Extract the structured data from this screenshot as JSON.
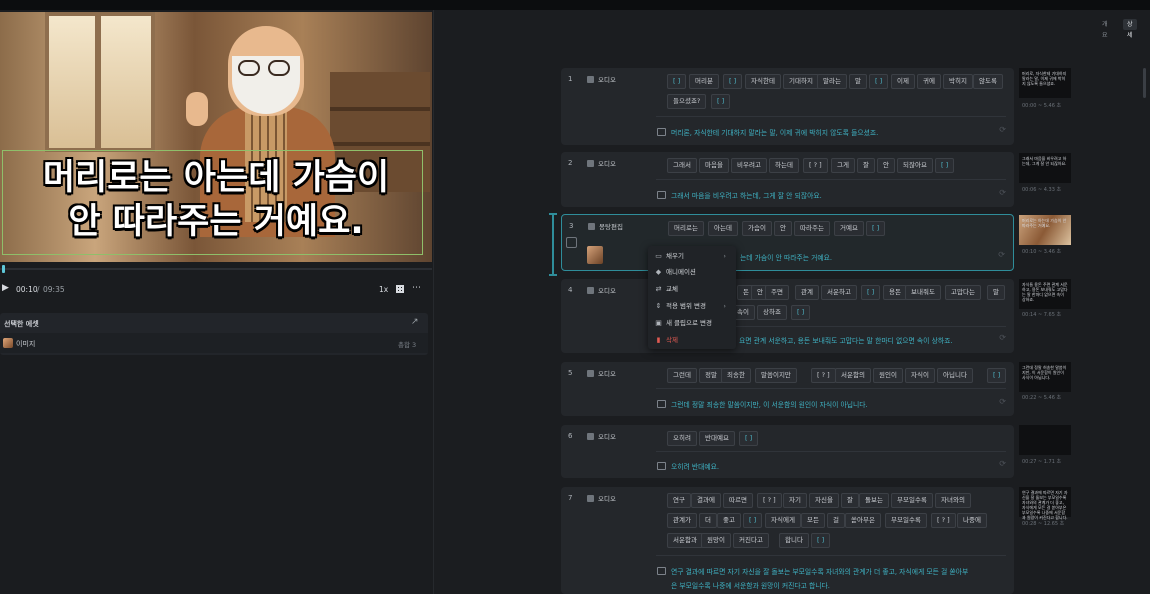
{
  "video": {
    "subtitle_line1": "머리로는 아는데 가슴이",
    "subtitle_line2": "안 따라주는 거예요.",
    "time_current": "00:10",
    "time_sep": "/",
    "time_total": "09:35",
    "speed": "1x"
  },
  "assets": {
    "title": "선택한 에셋",
    "item_label": "이미지",
    "item_count": "총합 3"
  },
  "view_tabs": [
    "개요",
    "상세"
  ],
  "rows": [
    {
      "num": "1",
      "type": "오디오",
      "thumb_text": "머리로, 자식한테 기대하지 말라는 말, 이제 귀에 박히지 않도록 들으셨죠.",
      "thumb_time": "00:00 ~ 5.46 초",
      "words": [
        "[ ]",
        "머리분",
        "[ ]",
        "자식한테",
        "기대하지",
        "말라는",
        "말",
        "[ ]",
        "이제",
        "귀에",
        "박히지",
        "않도록",
        "들으셨죠?",
        "[ ]"
      ],
      "sentence": "머리론, 자식한테 기대하지 말라는 말, 이제 귀에 박히지 않도록 들으셨죠."
    },
    {
      "num": "2",
      "type": "오디오",
      "thumb_text": "그래서 마음을 비우려고 하는데, 그게 잘 안 되잖아요.",
      "thumb_time": "00:06 ~ 4.33 초",
      "words": [
        "그래서",
        "마음을",
        "비우려고",
        "하는데",
        "[ ? ]",
        "그게",
        "잘",
        "안",
        "되잖아요",
        "[ ]"
      ],
      "sentence": "그래서 마음을 비우려고 하는데, 그게 잘 안 되잖아요."
    },
    {
      "num": "3",
      "type": "몽탕편집",
      "thumb_text": "머리로는 아는데 가슴이 안 따라주는 거예요.",
      "thumb_time": "00:10 ~ 3.46 초",
      "words": [
        "머리로는",
        "아는데",
        "가슴이",
        "안",
        "따라주는",
        "거예요",
        "[ ]"
      ],
      "sentence": "는데 가슴이 안 따라주는 거예요."
    },
    {
      "num": "4",
      "type": "오디오",
      "thumb_text": "자식들 용돈 주면 관계 서운하고, 용돈 보내줘도 고맙다는 말 한마디 없으면 속이 상하죠.",
      "thumb_time": "00:14 ~ 7.65 초",
      "words": [
        "돈",
        "안",
        "주면",
        "관계",
        "서운하고",
        "[ ]",
        "용돈",
        "보내줘도",
        "고맙다는",
        "말",
        "속이",
        "상하죠",
        "[ ]"
      ],
      "sentence": "요면 관계 서운하고, 용돈 보내줘도 고맙다는 말 한마디 없으면 속이 상하죠."
    },
    {
      "num": "5",
      "type": "오디오",
      "thumb_text": "그런데 정말 허송한 말씀이지만, 이 서운함이 원인이 사식이 아닙니다.",
      "thumb_time": "00:22 ~ 5.46 초",
      "words": [
        "그런데",
        "정말",
        "죄송한",
        "말씀이지만",
        "[ ? ]",
        "서운함의",
        "원인이",
        "자식이",
        "아닙니다",
        "[ ]"
      ],
      "sentence": "그런데 정말 죄송한 말씀이지만, 이 서운함의 원인이 자식이 아닙니다."
    },
    {
      "num": "6",
      "type": "오디오",
      "thumb_text": "",
      "thumb_time": "00:27 ~ 1.71 초",
      "words": [
        "오히려",
        "반대예요",
        "[ ]"
      ],
      "sentence": "오히려 반대예요."
    },
    {
      "num": "7",
      "type": "오디오",
      "thumb_text": "연구 결과에 따르면 자기 자신을 잘 돌보는 부모일수록 자녀와의 관계가 더 좋고, 자식에게 모든 걸 쏟아부은 부모일수록 나중에 서운함과 원망이 커진다고 합니다.",
      "thumb_time": "00:28 ~ 12.65 초",
      "words_line1": [
        "연구",
        "결과에",
        "따르면",
        "[ ? ]",
        "자기",
        "자신을",
        "잘",
        "돌보는",
        "부모일수록",
        "자녀와의"
      ],
      "words_line2": [
        "관계가",
        "더",
        "좋고",
        "[ ]",
        "자식에게",
        "모든",
        "걸",
        "쏟아부은",
        "부모일수록",
        "[ ? ]",
        "나중에"
      ],
      "words_line3": [
        "서운함과",
        "원망이",
        "커진다고",
        "합니다",
        "[ ]"
      ],
      "sentence1": "연구 결과에 따르면 자기 자신을 잘 돌보는 부모일수록 자녀와의 관계가 더 좋고, 자식에게 모든 걸 쏟아부",
      "sentence2": "은 부모일수록 나중에 서운함과 원망이 커진다고 합니다."
    }
  ],
  "context_menu": {
    "fill": "채우기",
    "animation": "애니메이션",
    "replace": "교체",
    "range": "적용 범위 변경",
    "new_clip": "새 클립으로 변경",
    "delete": "삭제"
  },
  "colors": {
    "accent": "#2f8d9a",
    "sentence": "#3fb3c4",
    "danger": "#e05a52"
  }
}
